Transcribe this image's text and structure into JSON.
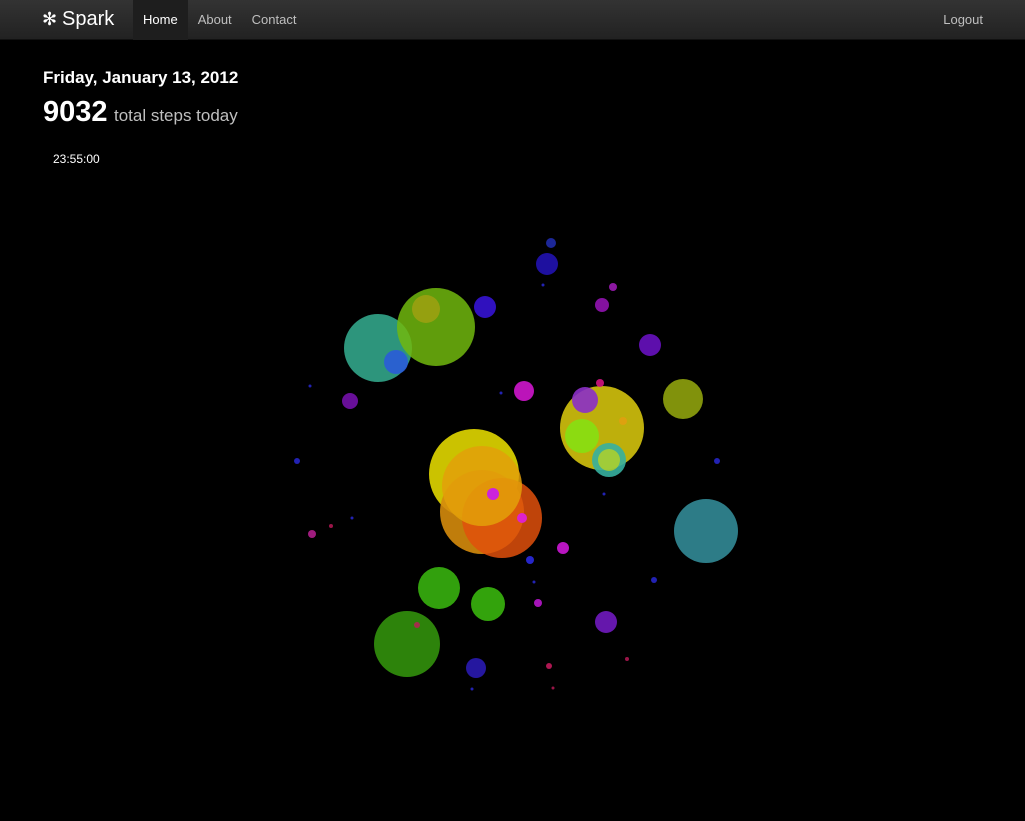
{
  "navbar": {
    "brand_icon": "✻",
    "brand_label": "Spark",
    "links": [
      {
        "label": "Home",
        "active": true
      },
      {
        "label": "About",
        "active": false
      },
      {
        "label": "Contact",
        "active": false
      }
    ],
    "logout_label": "Logout"
  },
  "summary": {
    "date": "Friday, January 13, 2012",
    "steps_count": "9032",
    "steps_label": "total steps today",
    "time": "23:55:00"
  },
  "colors": {
    "background": "#000000",
    "navbar_top": "#333333",
    "navbar_bottom": "#222222",
    "active_link_bg": "#1e1e1e",
    "muted_text": "#bfbfbf"
  }
}
